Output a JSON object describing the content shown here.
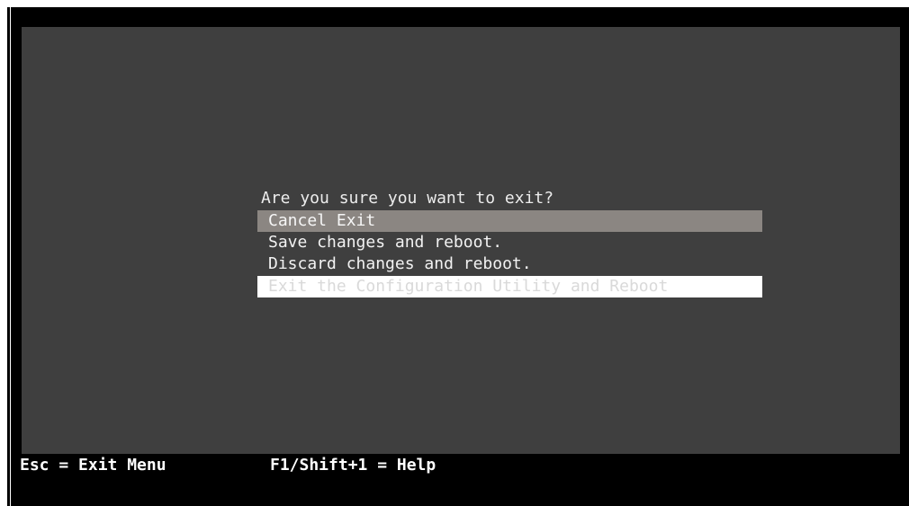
{
  "dialog": {
    "prompt": "Are you sure you want to exit?",
    "items": [
      {
        "label": "Cancel Exit",
        "state": "highlighted"
      },
      {
        "label": "Save changes and reboot.",
        "state": "normal"
      },
      {
        "label": "Discard changes and reboot.",
        "state": "normal"
      },
      {
        "label": "Exit the Configuration Utility and Reboot",
        "state": "white-bar"
      }
    ]
  },
  "status_bar": {
    "esc_hint": "Esc = Exit Menu",
    "help_hint": "F1/Shift+1 = Help"
  },
  "colors": {
    "background": "#3f3f3f",
    "frame": "#000000",
    "highlight": "#8b8682",
    "text": "#f2f2f2"
  }
}
